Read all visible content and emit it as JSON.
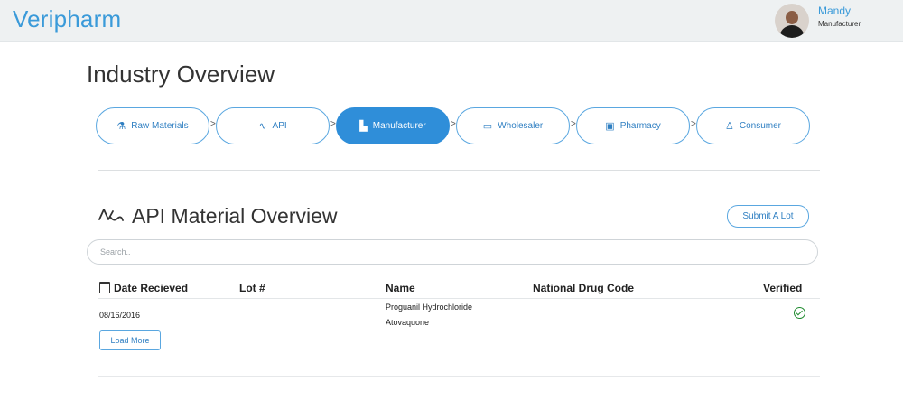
{
  "header": {
    "brand": "Veripharm",
    "user": {
      "name": "Mandy",
      "role": "Manufacturer"
    }
  },
  "page_title": "Industry Overview",
  "pipeline": [
    {
      "label": "Raw Materials",
      "icon": "flask-icon"
    },
    {
      "label": "API",
      "icon": "wave-icon"
    },
    {
      "label": "Manufacturer",
      "icon": "factory-icon",
      "active": true
    },
    {
      "label": "Wholesaler",
      "icon": "truck-icon"
    },
    {
      "label": "Pharmacy",
      "icon": "store-icon"
    },
    {
      "label": "Consumer",
      "icon": "user-icon"
    }
  ],
  "section": {
    "title": "API Material Overview",
    "icon": "wave-icon",
    "submit_label": "Submit A Lot"
  },
  "search": {
    "placeholder": "Search..",
    "value": ""
  },
  "table": {
    "columns": [
      "Date Recieved",
      "Lot #",
      "Name",
      "National Drug Code",
      "Verified"
    ],
    "rows": [
      {
        "date": "08/16/2016",
        "lot": "",
        "name_lines": [
          "Proguanil Hydrochloride",
          "Atovaquone"
        ],
        "ndc": "",
        "verified": true
      }
    ],
    "load_more_label": "Load More"
  },
  "colors": {
    "brand": "#3a9ad9",
    "accent": "#2f8ed9",
    "verified": "#1e8a2e"
  }
}
